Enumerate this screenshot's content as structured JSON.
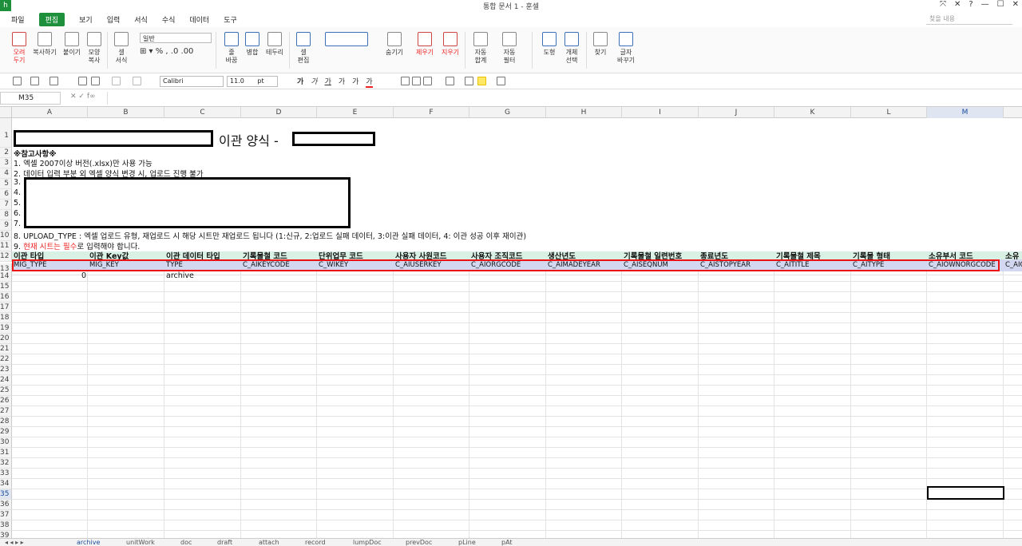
{
  "app": {
    "title": "통합 문서 1 - 훈셀",
    "logo_letter": "h"
  },
  "window_buttons": [
    "⤧",
    "✕",
    "?",
    "—",
    "☐",
    "✕"
  ],
  "menu": [
    "파일",
    "편집",
    "보기",
    "입력",
    "서식",
    "수식",
    "데이터",
    "도구"
  ],
  "search": {
    "placeholder": "찾을 내용"
  },
  "ribbon": {
    "buttons": [
      {
        "name": "cut",
        "label": "오려\n두기"
      },
      {
        "name": "copy",
        "label": "복사하기"
      },
      {
        "name": "paste",
        "label": "붙이기"
      },
      {
        "name": "format-copy",
        "label": "모양\n복사"
      },
      {
        "name": "cell-format",
        "label": "셀\n서식"
      },
      {
        "name": "wrap",
        "label": "줄\n바꿈"
      },
      {
        "name": "merge",
        "label": "병합"
      },
      {
        "name": "border",
        "label": "테두리"
      },
      {
        "name": "cell-edit",
        "label": "셀\n편집"
      },
      {
        "name": "hide",
        "label": "숨기기"
      },
      {
        "name": "remove",
        "label": "제우기"
      },
      {
        "name": "clear",
        "label": "지우기"
      },
      {
        "name": "autosum",
        "label": "자동\n합계"
      },
      {
        "name": "autofilter",
        "label": "자동\n필터"
      },
      {
        "name": "shape",
        "label": "도형"
      },
      {
        "name": "object-select",
        "label": "개체\n선택"
      },
      {
        "name": "find",
        "label": "찾기"
      },
      {
        "name": "replace",
        "label": "글자\n바꾸기"
      }
    ],
    "number_format": "일반"
  },
  "toolbar": {
    "font": "Calibri",
    "size": "11.0",
    "size_unit": "pt",
    "fmt": [
      "가",
      "가",
      "가",
      "가",
      "가",
      "가"
    ]
  },
  "formula": {
    "cell_ref": "M35",
    "fx": "f∞",
    "content": ""
  },
  "columns": [
    "A",
    "B",
    "C",
    "D",
    "E",
    "F",
    "G",
    "H",
    "I",
    "J",
    "K",
    "L",
    "M",
    ""
  ],
  "selected_column": "M",
  "rows": {
    "first": 1,
    "last": 39
  },
  "sheet": {
    "title_mid": "이관 양식 -",
    "notes_header": "※참고사항※",
    "note1": "1. 엑셀 2007이상 버전(.xlsx)만 사용 가능",
    "note2": "2. 데이터 입력 부분 외 엑셀 양식 변경 시, 업로드 진행 불가",
    "note3": "3.",
    "note4": "4.",
    "note5": "5.",
    "note6": "6.",
    "note7": "7.",
    "note8": "8. UPLOAD_TYPE : 엑셀 업로드 유형, 재업로드 시 해당 시트만 재업로드 됩니다 (1:신규, 2:업로드 실패 데이터, 3:이관 실패 데이터, 4: 이관 성공 이후 재이관)",
    "note9_prefix": "9.",
    "note9_red": "현재 시트는 필수",
    "note9_suffix": "로 입력해야 합니다.",
    "header_kr": [
      "이관 타입",
      "이관 Key값",
      "이관 데이터 타입",
      "기록물철 코드",
      "단위업무 코드",
      "사용자 사원코드",
      "사용자 조직코드",
      "생산년도",
      "기록물철 일련번호",
      "종료년도",
      "기록물철 제목",
      "기록물 형태",
      "소유부서 코드",
      "소유"
    ],
    "header_en": [
      "MIG_TYPE",
      "MIG_KEY",
      "TYPE",
      "C_AIKEYCODE",
      "C_WIKEY",
      "C_AIUSERKEY",
      "C_AIORGCODE",
      "C_AIMADEYEAR",
      "C_AISEQNUM",
      "C_AISTOPYEAR",
      "C_AITITLE",
      "C_AITYPE",
      "C_AIOWNORGCODE",
      "C_AIO"
    ],
    "row14": {
      "a": "0",
      "c": "archive"
    }
  },
  "sheet_tabs": [
    "archive",
    "unitWork",
    "doc",
    "draft",
    "attach",
    "record",
    "lumpDoc",
    "prevDoc",
    "pLine",
    "pAt"
  ],
  "active_tab": "archive"
}
